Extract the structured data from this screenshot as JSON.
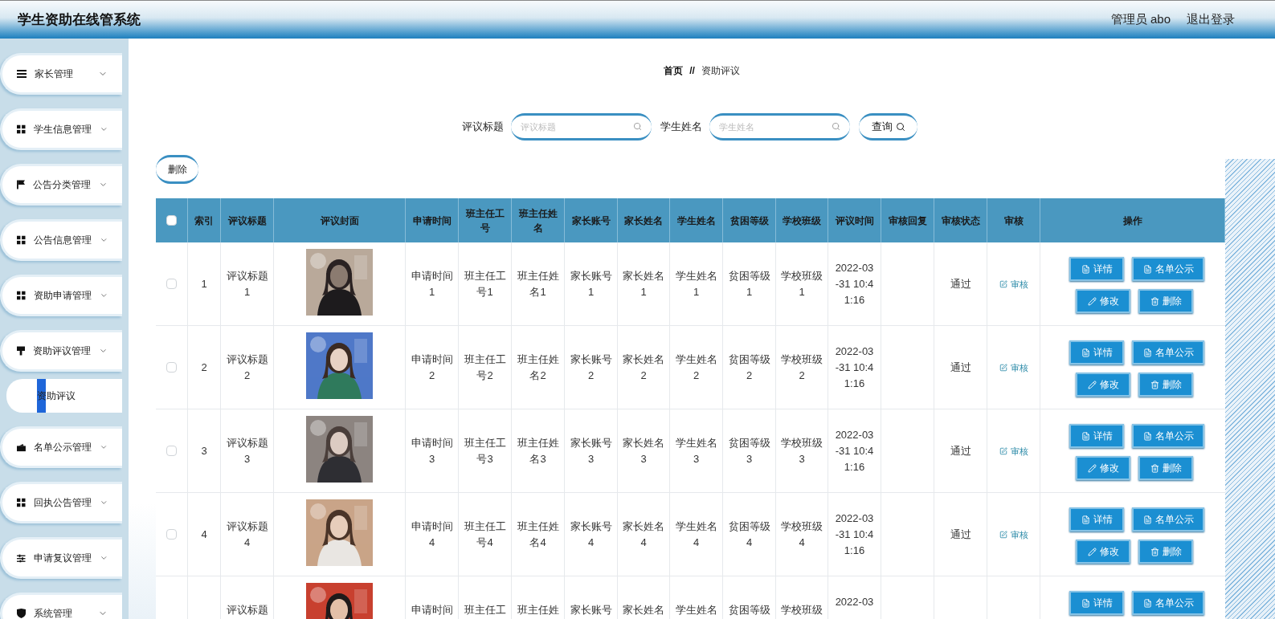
{
  "header": {
    "title": "学生资助在线管系统",
    "user": "管理员 abo",
    "logout": "退出登录"
  },
  "sidebar": {
    "items": [
      {
        "label": "家长管理"
      },
      {
        "label": "学生信息管理"
      },
      {
        "label": "公告分类管理"
      },
      {
        "label": "公告信息管理"
      },
      {
        "label": "资助申请管理"
      },
      {
        "label": "资助评议管理",
        "children": [
          {
            "label": "资助评议",
            "selected": true
          }
        ]
      },
      {
        "label": "名单公示管理"
      },
      {
        "label": "回执公告管理"
      },
      {
        "label": "申请复议管理"
      },
      {
        "label": "系统管理"
      }
    ]
  },
  "breadcrumb": {
    "home": "首页",
    "separator": "//",
    "current": "资助评议"
  },
  "search": {
    "fields": [
      {
        "label": "评议标题",
        "placeholder": "评议标题"
      },
      {
        "label": "学生姓名",
        "placeholder": "学生姓名"
      }
    ],
    "button": "查询"
  },
  "delete_button": "删除",
  "table": {
    "header_checkbox": {
      "checked": false
    },
    "columns": [
      "索引",
      "评议标题",
      "评议封面",
      "申请时间",
      "班主任工号",
      "班主任姓名",
      "家长账号",
      "家长姓名",
      "学生姓名",
      "贫困等级",
      "学校班级",
      "评议时间",
      "审核回复",
      "审核状态",
      "审核",
      "操作"
    ],
    "rows": [
      {
        "checked": false,
        "index": "1",
        "title": "评议标题1",
        "cover": {
          "kind": "picture"
        },
        "apply_time": "申请时间1",
        "teacher_id": "班主任工号1",
        "teacher_name": "班主任姓名1",
        "parent_account": "家长账号1",
        "parent_name": "家长姓名1",
        "student_name": "学生姓名1",
        "poverty_level": "贫困等级1",
        "school_class": "学校班级1",
        "review_time": "2022-03-31 10:41:16",
        "status": "通过",
        "review_link": "审核",
        "actions": [
          "详情",
          "名单公示",
          "修改",
          "删除"
        ]
      },
      {
        "checked": false,
        "index": "2",
        "title": "评议标题2",
        "cover": {
          "kind": "picture"
        },
        "apply_time": "申请时间2",
        "teacher_id": "班主任工号2",
        "teacher_name": "班主任姓名2",
        "parent_account": "家长账号2",
        "parent_name": "家长姓名2",
        "student_name": "学生姓名2",
        "poverty_level": "贫困等级2",
        "school_class": "学校班级2",
        "review_time": "2022-03-31 10:41:16",
        "status": "通过",
        "review_link": "审核",
        "actions": [
          "详情",
          "名单公示",
          "修改",
          "删除"
        ]
      },
      {
        "checked": false,
        "index": "3",
        "title": "评议标题3",
        "cover": {
          "kind": "picture"
        },
        "apply_time": "申请时间3",
        "teacher_id": "班主任工号3",
        "teacher_name": "班主任姓名3",
        "parent_account": "家长账号3",
        "parent_name": "家长姓名3",
        "student_name": "学生姓名3",
        "poverty_level": "贫困等级3",
        "school_class": "学校班级3",
        "review_time": "2022-03-31 10:41:16",
        "status": "通过",
        "review_link": "审核",
        "actions": [
          "详情",
          "名单公示",
          "修改",
          "删除"
        ]
      },
      {
        "checked": false,
        "index": "4",
        "title": "评议标题4",
        "cover": {
          "kind": "picture"
        },
        "apply_time": "申请时间4",
        "teacher_id": "班主任工号4",
        "teacher_name": "班主任姓名4",
        "parent_account": "家长账号4",
        "parent_name": "家长姓名4",
        "student_name": "学生姓名4",
        "poverty_level": "贫困等级4",
        "school_class": "学校班级4",
        "review_time": "2022-03-31 10:41:16",
        "status": "通过",
        "review_link": "审核",
        "actions": [
          "详情",
          "名单公示",
          "修改",
          "删除"
        ]
      },
      {
        "title": "评议标题",
        "cover": {
          "kind": "picture"
        },
        "apply_time": "申请时间",
        "teacher_id": "班主任工",
        "teacher_name": "班主任姓",
        "parent_account": "家长账号",
        "parent_name": "家长姓名",
        "student_name": "学生姓名",
        "poverty_level": "贫困等级",
        "school_class": "学校班级",
        "review_time": "2022-03",
        "actions": [
          "详情",
          "名单公示"
        ]
      }
    ]
  }
}
